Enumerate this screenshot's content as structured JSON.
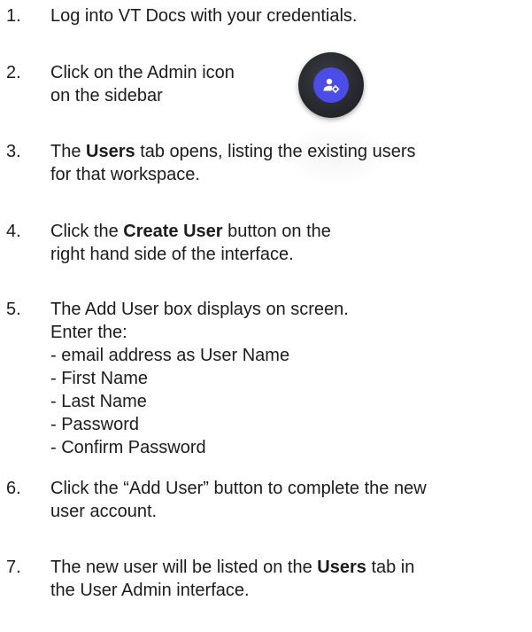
{
  "steps": [
    {
      "num": "1.",
      "lines": [
        [
          {
            "t": "Log into VT Docs with your credentials."
          }
        ]
      ]
    },
    {
      "num": "2.",
      "lines": [
        [
          {
            "t": "Click on the Admin icon"
          }
        ],
        [
          {
            "t": "on the sidebar"
          }
        ]
      ]
    },
    {
      "num": "3.",
      "lines": [
        [
          {
            "t": "The "
          },
          {
            "t": "Users",
            "b": true
          },
          {
            "t": " tab opens, listing the existing users"
          }
        ],
        [
          {
            "t": "for that workspace."
          }
        ]
      ]
    },
    {
      "num": "4.",
      "lines": [
        [
          {
            "t": "Click the "
          },
          {
            "t": "Create User",
            "b": true
          },
          {
            "t": " button on the"
          }
        ],
        [
          {
            "t": "right hand side of the interface."
          }
        ]
      ]
    },
    {
      "num": "5.",
      "lines": [
        [
          {
            "t": "The Add User box displays on screen."
          }
        ],
        [
          {
            "t": "Enter the:"
          }
        ],
        [
          {
            "t": "- email address as User Name"
          }
        ],
        [
          {
            "t": "- First Name"
          }
        ],
        [
          {
            "t": "- Last Name"
          }
        ],
        [
          {
            "t": "- Password"
          }
        ],
        [
          {
            "t": "- Confirm Password"
          }
        ]
      ]
    },
    {
      "num": "6.",
      "lines": [
        [
          {
            "t": "Click the “Add User” button to complete the new"
          }
        ],
        [
          {
            "t": "user account."
          }
        ]
      ]
    },
    {
      "num": "7.",
      "lines": [
        [
          {
            "t": "The new user will be listed on the "
          },
          {
            "t": "Users",
            "b": true
          },
          {
            "t": " tab in"
          }
        ],
        [
          {
            "t": "the User Admin interface."
          }
        ]
      ]
    }
  ],
  "admin_icon": {
    "icon": "admin-user-gear-icon",
    "bg_color": "#4a4de6",
    "ring_color": "#23252a"
  }
}
